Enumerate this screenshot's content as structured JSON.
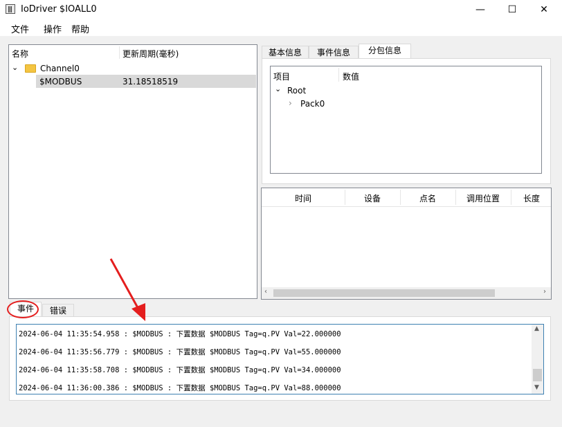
{
  "window": {
    "title": "IoDriver $IOALL0",
    "minimize_icon": "—",
    "maximize_icon": "☐",
    "close_icon": "✕"
  },
  "menu": [
    {
      "label": "文件"
    },
    {
      "label": "操作"
    },
    {
      "label": "帮助"
    }
  ],
  "tree": {
    "columns": [
      "名称",
      "更新周期(毫秒)"
    ],
    "channel": "Channel0",
    "device": {
      "name": "$MODBUS",
      "period": "31.18518519"
    }
  },
  "right_tabs": [
    {
      "label": "基本信息"
    },
    {
      "label": "事件信息"
    },
    {
      "label": "分包信息"
    }
  ],
  "packet_tree": {
    "columns": [
      "项目",
      "数值"
    ],
    "root": "Root",
    "child": "Pack0"
  },
  "packet_table": {
    "columns": [
      "时间",
      "设备",
      "点名",
      "调用位置",
      "长度"
    ]
  },
  "bottom_tabs": [
    {
      "label": "事件"
    },
    {
      "label": "错误"
    }
  ],
  "events": [
    "2024-06-04 11:35:54.958 : $MODBUS : 下置数据 $MODBUS Tag=q.PV Val=22.000000",
    "2024-06-04 11:35:56.779 : $MODBUS : 下置数据 $MODBUS Tag=q.PV Val=55.000000",
    "2024-06-04 11:35:58.708 : $MODBUS : 下置数据 $MODBUS Tag=q.PV Val=34.000000",
    "2024-06-04 11:36:00.386 : $MODBUS : 下置数据 $MODBUS Tag=q.PV Val=88.000000"
  ],
  "colors": {
    "annotation": "#e41e1e",
    "selection": "#d9d9d9",
    "border": "#828790"
  }
}
